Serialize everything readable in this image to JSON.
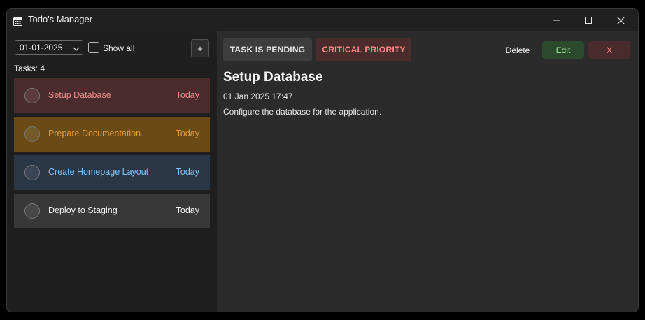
{
  "window": {
    "title": "Todo's Manager",
    "icon": "calendar-icon"
  },
  "sidebar": {
    "date_filter": "01-01-2025",
    "show_all_label": "Show all",
    "show_all_checked": false,
    "add_label": "+",
    "task_count": "Tasks: 4",
    "tasks": [
      {
        "title": "Setup Database",
        "due": "Today",
        "bg": "#4a2c2e",
        "color": "#f08a8a"
      },
      {
        "title": "Prepare Documentation",
        "due": "Today",
        "bg": "#6a4b16",
        "color": "#e09a3a"
      },
      {
        "title": "Create Homepage Layout",
        "due": "Today",
        "bg": "#2a3546",
        "color": "#7ec3f3"
      },
      {
        "title": "Deploy to Staging",
        "due": "Today",
        "bg": "#383838",
        "color": "#f2f2f2"
      }
    ]
  },
  "detail": {
    "status_badge": "TASK IS PENDING",
    "priority_badge": "CRITICAL PRIORITY",
    "delete_label": "Delete",
    "edit_label": "Edit",
    "close_label": "X",
    "title": "Setup Database",
    "datetime": "01 Jan 2025 17:47",
    "description": "Configure the database for the application."
  },
  "colors": {
    "window_bg": "#202020",
    "main_bg": "#2b2b2b",
    "critical": "#ff8d8d",
    "edit_green": "#9fe39f"
  }
}
